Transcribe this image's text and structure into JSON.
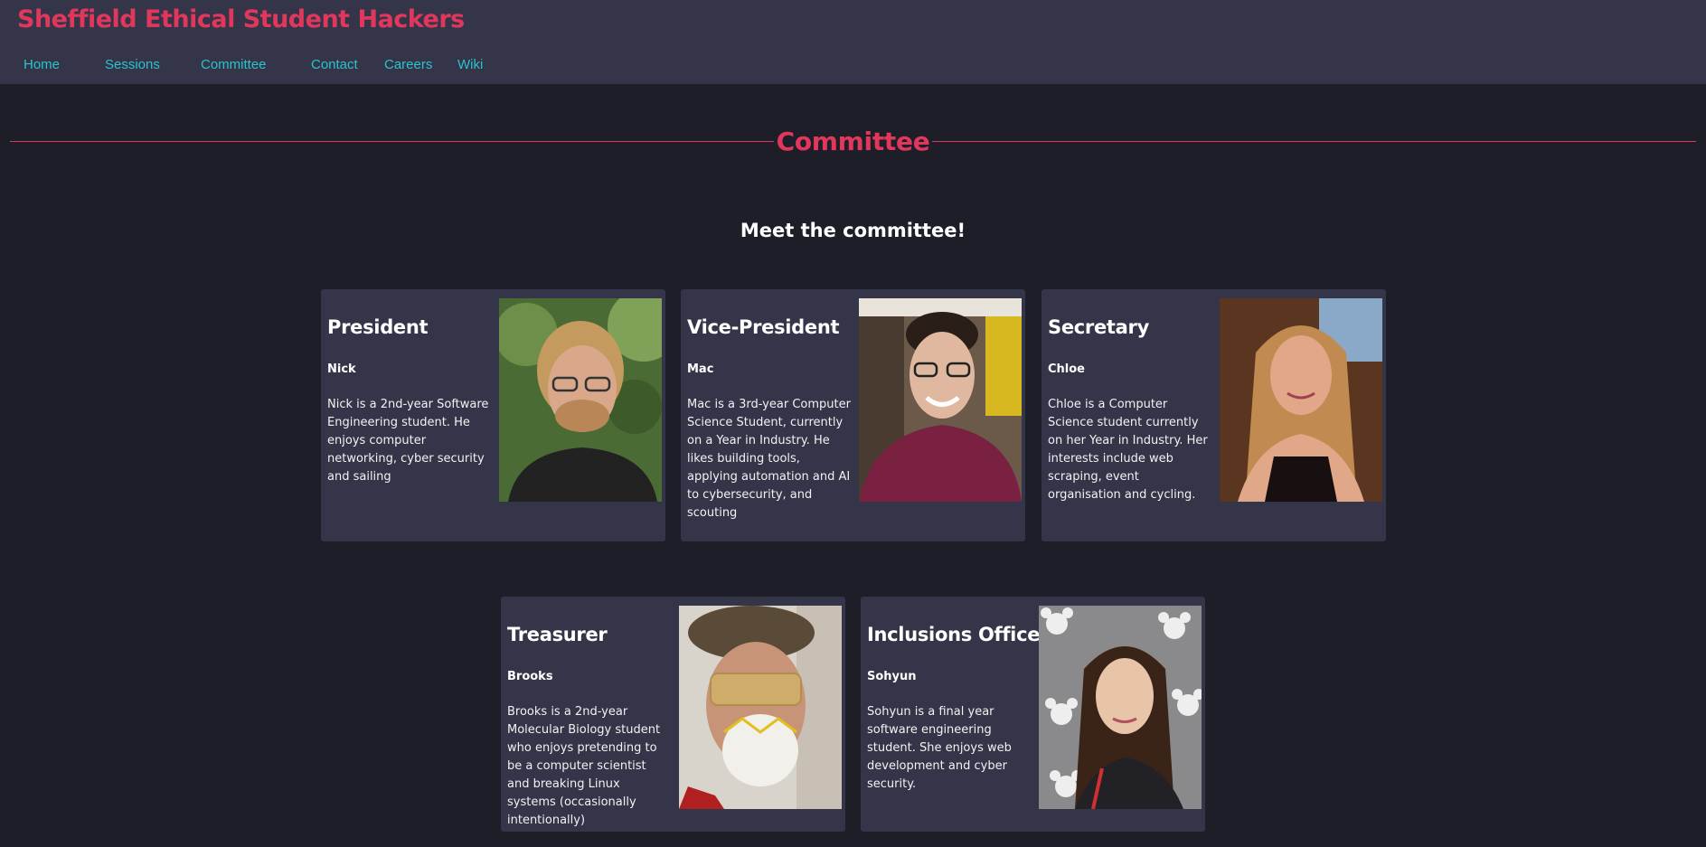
{
  "site": {
    "title": "Sheffield Ethical Student Hackers"
  },
  "nav": {
    "home": "Home",
    "sessions": "Sessions",
    "committee": "Committee",
    "contact": "Contact",
    "careers": "Careers",
    "wiki": "Wiki"
  },
  "page": {
    "section_title": "Committee",
    "subtitle": "Meet the committee!"
  },
  "members": [
    {
      "role": "President",
      "name": "Nick",
      "bio": "Nick is a 2nd-year Software Engineering student. He enjoys computer networking, cyber security and sailing"
    },
    {
      "role": "Vice-President",
      "name": "Mac",
      "bio": "Mac is a 3rd-year Computer Science Student, currently on a Year in Industry. He likes building tools, applying automation and AI to cybersecurity, and scouting"
    },
    {
      "role": "Secretary",
      "name": "Chloe",
      "bio": "Chloe is a Computer Science student currently on her Year in Industry. Her interests include web scraping, event organisation and cycling."
    },
    {
      "role": "Treasurer",
      "name": "Brooks",
      "bio": "Brooks is a 2nd-year Molecular Biology student who enjoys pretending to be a computer scientist and breaking Linux systems (occasionally intentionally)"
    },
    {
      "role": "Inclusions Officer",
      "name": "Sohyun",
      "bio": "Sohyun is a final year software engineering student. She enjoys web development and cyber security."
    }
  ],
  "colors": {
    "background": "#1d1e28",
    "header": "#343548",
    "card": "#343548",
    "accent": "#e2375d",
    "nav_link": "#2bc3ce"
  }
}
